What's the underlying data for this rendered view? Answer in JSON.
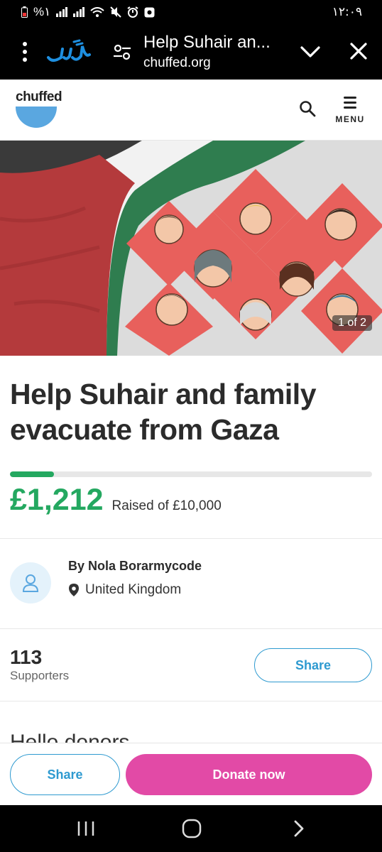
{
  "status_bar": {
    "left_text": "%١",
    "time": "١٢:٠٩",
    "icons": [
      "battery-icon",
      "signal-icon",
      "signal-icon",
      "wifi-icon",
      "mute-icon",
      "alarm-icon",
      "app-notification-icon"
    ]
  },
  "browser": {
    "logo_text": "سَرَ",
    "page_title": "Help Suhair an...",
    "host": "chuffed.org"
  },
  "header": {
    "logo_text": "chuffed",
    "menu_label": "MENU"
  },
  "hero": {
    "counter": "1 of 2"
  },
  "campaign": {
    "title": "Help Suhair and family evacuate from Gaza",
    "raised_amount": "£1,212",
    "raised_label": "Raised of £10,000",
    "progress_fraction": 0.1212
  },
  "organiser": {
    "name": "By Nola Borarmycode",
    "location": "United Kingdom"
  },
  "supporters": {
    "count": "113",
    "label": "Supporters",
    "share_label": "Share"
  },
  "story": {
    "opening": "Hello donors"
  },
  "action_bar": {
    "share_label": "Share",
    "donate_label": "Donate now"
  },
  "colors": {
    "accent_green": "#24a860",
    "share_blue": "#2e9ad0",
    "donate_pink": "#e24aa6",
    "logo_blue": "#5aa7e0"
  }
}
